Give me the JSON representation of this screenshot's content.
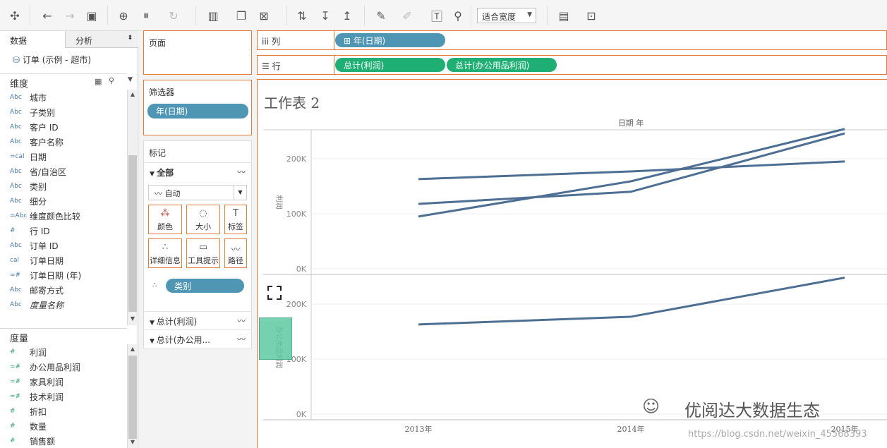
{
  "toolbar": {
    "fit_label": "适合宽度",
    "icons": [
      "tableau-logo-icon",
      "undo-icon",
      "redo-icon",
      "save-icon",
      "new-datasource-icon",
      "pause-icon",
      "refresh-icon",
      "new-sheet-icon",
      "duplicate-icon",
      "clear-icon",
      "swap-icon",
      "sort-asc-icon",
      "sort-desc-icon",
      "highlight-icon",
      "paperclip-icon",
      "label-icon",
      "pin-icon",
      "show-me-icon",
      "presentation-icon"
    ]
  },
  "data_pane": {
    "tabs": [
      "数据",
      "分析"
    ],
    "source": "订单 (示例 - 超市)",
    "dimensions_title": "维度",
    "dimensions": [
      {
        "type": "Abc",
        "label": "城市"
      },
      {
        "type": "Abc",
        "label": "子类别"
      },
      {
        "type": "Abc",
        "label": "客户 ID"
      },
      {
        "type": "Abc",
        "label": "客户名称"
      },
      {
        "type": "=cal",
        "label": "日期"
      },
      {
        "type": "Abc",
        "label": "省/自治区"
      },
      {
        "type": "Abc",
        "label": "类别"
      },
      {
        "type": "Abc",
        "label": "细分"
      },
      {
        "type": "=Abc",
        "label": "维度颜色比较"
      },
      {
        "type": "#",
        "label": "行 ID"
      },
      {
        "type": "Abc",
        "label": "订单 ID"
      },
      {
        "type": "cal",
        "label": "订单日期"
      },
      {
        "type": "=#",
        "label": "订单日期 (年)"
      },
      {
        "type": "Abc",
        "label": "邮寄方式"
      },
      {
        "type": "Abc",
        "label": "度量名称"
      }
    ],
    "measures_title": "度量",
    "measures": [
      {
        "type": "#",
        "label": "利润"
      },
      {
        "type": "=#",
        "label": "办公用品利润"
      },
      {
        "type": "=#",
        "label": "家具利润"
      },
      {
        "type": "=#",
        "label": "技术利润"
      },
      {
        "type": "#",
        "label": "折扣"
      },
      {
        "type": "#",
        "label": "数量"
      },
      {
        "type": "#",
        "label": "销售额"
      }
    ]
  },
  "pages": {
    "title": "页面"
  },
  "filters": {
    "title": "筛选器",
    "pill": "年(日期)"
  },
  "marks": {
    "title": "标记",
    "all_label": "全部",
    "mark_type": "自动",
    "buttons": [
      "颜色",
      "大小",
      "标签",
      "详细信息",
      "工具提示",
      "路径"
    ],
    "detail_pill": "类别",
    "rows": [
      "总计(利润)",
      "总计(办公用..."
    ]
  },
  "columns_shelf": {
    "label": "列",
    "pill": "年(日期)"
  },
  "rows_shelf": {
    "label": "行",
    "pills": [
      "总计(利润)",
      "总计(办公用品利润)"
    ]
  },
  "view": {
    "sheet_title": "工作表 2",
    "header": "日期 年",
    "watermark": "优阅达大数据生态",
    "url": "https://blog.csdn.net/weixin_45568393"
  },
  "chart_data": [
    {
      "type": "line",
      "ylabel": "利润",
      "x": [
        "2013年",
        "2014年",
        "2015年"
      ],
      "yticks": [
        "0K",
        "100K",
        "200K"
      ],
      "ylim": [
        0,
        260000
      ],
      "series": [
        {
          "values": [
            163000,
            177000,
            195000
          ]
        },
        {
          "values": [
            118000,
            140000,
            246000
          ]
        },
        {
          "values": [
            95000,
            159000,
            254000
          ]
        }
      ]
    },
    {
      "type": "line",
      "ylabel": "办公用品利润",
      "x": [
        "2013年",
        "2014年",
        "2015年"
      ],
      "yticks": [
        "0K",
        "100K",
        "200K"
      ],
      "ylim": [
        0,
        260000
      ],
      "series": [
        {
          "values": [
            163000,
            177000,
            248000
          ]
        }
      ]
    }
  ],
  "colors": {
    "accent": "#e07b39",
    "blue_pill": "#4e96b4",
    "green_pill": "#1fae73",
    "line": "#4e6f94"
  }
}
